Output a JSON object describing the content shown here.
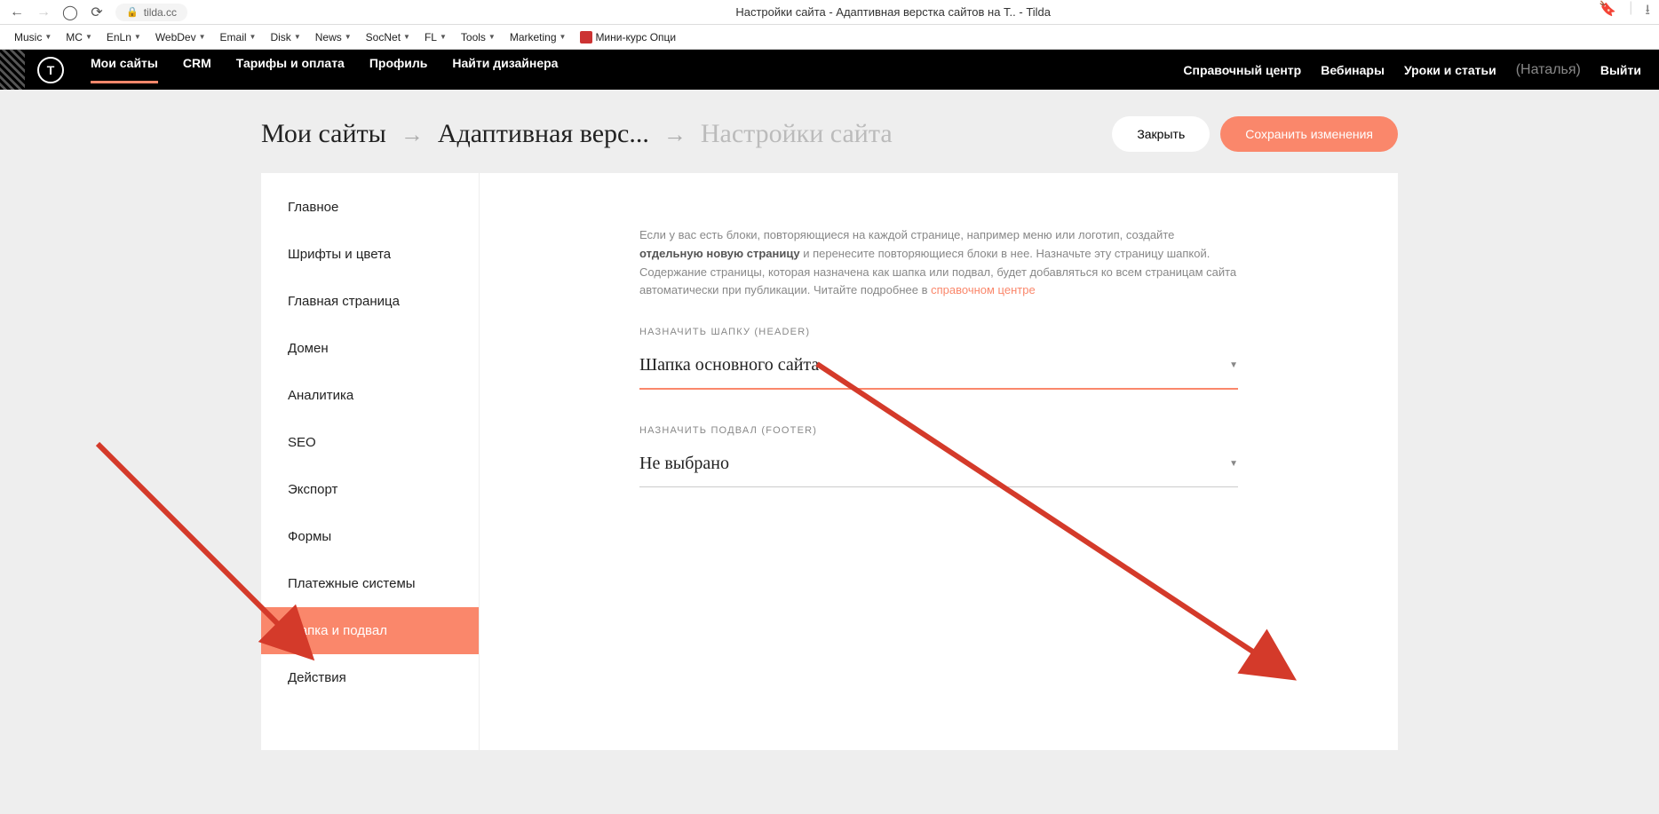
{
  "browser": {
    "url": "tilda.cc",
    "title": "Настройки сайта - Адаптивная верстка сайтов на Т.. - Tilda"
  },
  "bookmarks": [
    "Music",
    "MC",
    "EnLn",
    "WebDev",
    "Email",
    "Disk",
    "News",
    "SocNet",
    "FL",
    "Tools",
    "Marketing"
  ],
  "bookmark_extra": "Мини-курс Опци",
  "nav_left": [
    "Мои сайты",
    "CRM",
    "Тарифы и оплата",
    "Профиль",
    "Найти дизайнера"
  ],
  "nav_right": [
    "Справочный центр",
    "Вебинары",
    "Уроки и статьи"
  ],
  "user_label": "(Наталья)",
  "logout": "Выйти",
  "breadcrumbs": {
    "c1": "Мои сайты",
    "c2": "Адаптивная верс...",
    "c3": "Настройки сайта"
  },
  "buttons": {
    "close": "Закрыть",
    "save": "Сохранить изменения"
  },
  "sidebar": {
    "items": [
      "Главное",
      "Шрифты и цвета",
      "Главная страница",
      "Домен",
      "Аналитика",
      "SEO",
      "Экспорт",
      "Формы",
      "Платежные системы",
      "Шапка и подвал",
      "Действия"
    ],
    "active_index": 9
  },
  "main": {
    "help_pre": "Если у вас есть блоки, повторяющиеся на каждой странице, например меню или логотип, создайте ",
    "help_bold": "отдельную новую страницу",
    "help_post": " и перенесите повторяющиеся блоки в нее. Назначьте эту страницу шапкой. Содержание страницы, которая назначена как шапка или подвал, будет добавляться ко всем страницам сайта автоматически при публикации. Читайте подробнее в ",
    "help_link": "справочном центре",
    "header_label": "НАЗНАЧИТЬ ШАПКУ (HEADER)",
    "header_value": "Шапка основного сайта",
    "footer_label": "НАЗНАЧИТЬ ПОДВАЛ (FOOTER)",
    "footer_value": "Не выбрано"
  }
}
